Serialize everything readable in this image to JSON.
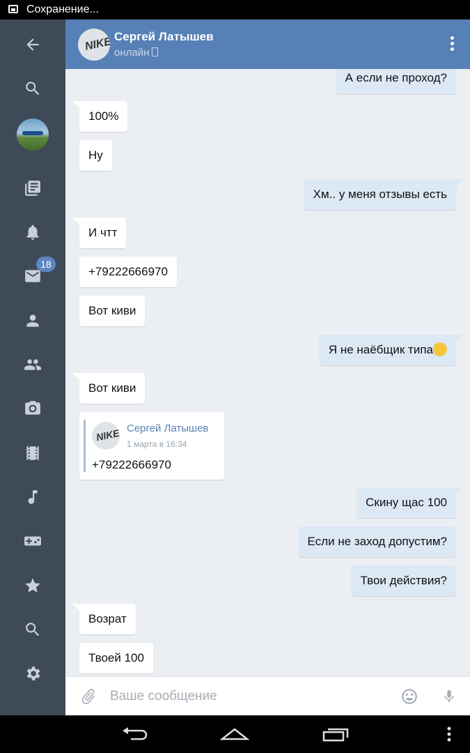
{
  "status_bar": {
    "text": "Сохранение..."
  },
  "sidebar": {
    "items": [
      {
        "icon": "back-arrow-icon"
      },
      {
        "icon": "search-icon"
      },
      {
        "icon": "user-avatar"
      },
      {
        "icon": "news-icon"
      },
      {
        "icon": "bell-icon"
      },
      {
        "icon": "mail-icon",
        "badge": "18"
      },
      {
        "icon": "person-icon"
      },
      {
        "icon": "friends-icon"
      },
      {
        "icon": "camera-icon"
      },
      {
        "icon": "film-icon"
      },
      {
        "icon": "music-icon"
      },
      {
        "icon": "gamepad-icon"
      },
      {
        "icon": "star-icon"
      },
      {
        "icon": "search-icon"
      },
      {
        "icon": "gear-icon"
      }
    ]
  },
  "header": {
    "name": "Сергей Латышев",
    "status": "онлайн",
    "avatar_text": "NIKE"
  },
  "messages": [
    {
      "dir": "out",
      "text": "А если не проход?"
    },
    {
      "dir": "in",
      "text": "100%"
    },
    {
      "dir": "in",
      "text": "Ну"
    },
    {
      "dir": "out",
      "text": "Хм.. у меня отзывы есть"
    },
    {
      "dir": "in",
      "text": "И чтт"
    },
    {
      "dir": "in",
      "text": "+79222666970"
    },
    {
      "dir": "in",
      "text": "Вот киви"
    },
    {
      "dir": "out",
      "text": "Я не наёбщик типа"
    },
    {
      "dir": "in",
      "text": "Вот киви"
    },
    {
      "dir": "out",
      "text": "Скину щас 100"
    },
    {
      "dir": "out",
      "text": "Если не заход допустим?"
    },
    {
      "dir": "out",
      "text": "Твои действия?"
    },
    {
      "dir": "in",
      "text": "Возрат"
    },
    {
      "dir": "in",
      "text": "Твоей 100"
    }
  ],
  "forwarded": {
    "name": "Сергей Латышев",
    "date": "1 марта в 16:34",
    "text": "+79222666970",
    "avatar_text": "NIKE"
  },
  "input": {
    "placeholder": "Ваше сообщение",
    "value": ""
  },
  "colors": {
    "header": "#5781b6",
    "sidebar": "#3f4a59",
    "chat_bg": "#ebeff3",
    "out_bubble": "#dde8f5"
  }
}
